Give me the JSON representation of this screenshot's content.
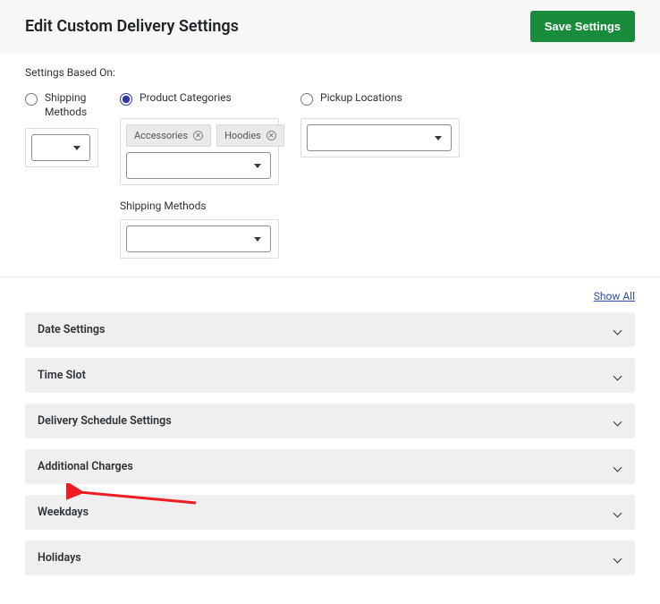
{
  "header": {
    "title": "Edit Custom Delivery Settings",
    "save_label": "Save Settings"
  },
  "settings_based_on_label": "Settings Based On:",
  "options": {
    "shipping_methods": {
      "label": "Shipping Methods",
      "selected": false
    },
    "product_categories": {
      "label": "Product Categories",
      "selected": true,
      "tags": [
        "Accessories",
        "Hoodies"
      ],
      "sub_label": "Shipping Methods"
    },
    "pickup_locations": {
      "label": "Pickup Locations",
      "selected": false
    }
  },
  "show_all_label": "Show All",
  "accordions": [
    "Date Settings",
    "Time Slot",
    "Delivery Schedule Settings",
    "Additional Charges",
    "Weekdays",
    "Holidays"
  ]
}
